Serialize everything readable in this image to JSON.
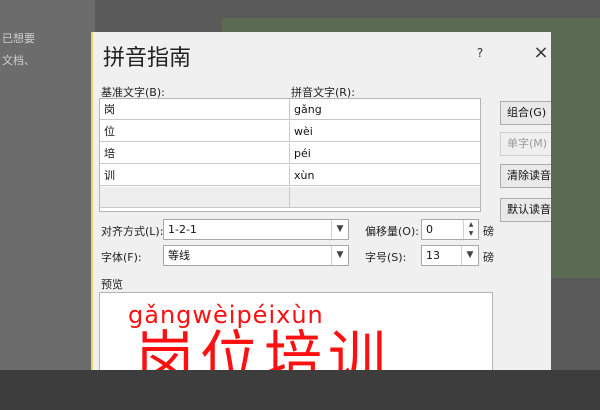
{
  "background": {
    "doc_line_1": "已想要",
    "doc_line_2": "文档、"
  },
  "dialog": {
    "title": "拼音指南",
    "help": "?",
    "close": "×"
  },
  "labels": {
    "base_text": "基准文字(B):",
    "ruby_text": "拼音文字(R):",
    "alignment": "对齐方式(L):",
    "offset": "偏移量(O):",
    "font": "字体(F):",
    "size": "字号(S):",
    "preview": "预览"
  },
  "rows": [
    {
      "base": "岗",
      "ruby": "gǎng"
    },
    {
      "base": "位",
      "ruby": "wèi"
    },
    {
      "base": "培",
      "ruby": "péi"
    },
    {
      "base": "训",
      "ruby": "xùn"
    },
    {
      "base": "",
      "ruby": ""
    }
  ],
  "buttons": {
    "group": "组合(G)",
    "mono": "单字(M)",
    "clear": "清除读音",
    "default": "默认读音"
  },
  "fields": {
    "alignment_value": "1-2-1",
    "offset_value": "0",
    "offset_unit": "磅",
    "font_value": "等线",
    "size_value": "13",
    "size_unit": "磅"
  },
  "preview": {
    "ruby": "gǎngwèipéixùn",
    "base": "岗位培训"
  },
  "colors": {
    "preview_text": "#ff1010",
    "dialog_bg": "#f0f0f0"
  }
}
